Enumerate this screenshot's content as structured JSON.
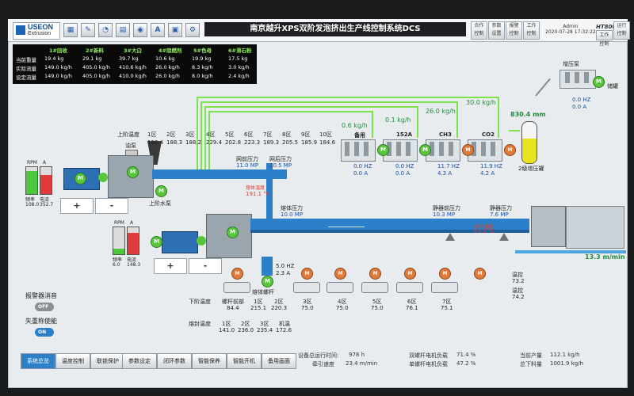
{
  "header": {
    "logo_top": "USEON",
    "logo_bottom": "Extrusion",
    "title": "南京越升XPS双阶发泡挤出生产线控制系统DCS",
    "buttons": [
      "合作\n控制",
      "参数\n设置",
      "报警\n控制",
      "工作\n控制",
      "工作\n控制",
      "运行\n控制"
    ],
    "user": "Admin",
    "datetime": "2020-07-28 17:32:22",
    "brand": "HT8000"
  },
  "feed_table": {
    "columns": [
      "1#回收",
      "2#新料",
      "3#大白",
      "4#阻燃剂",
      "5#色母",
      "6#滑石粉"
    ],
    "row_labels": [
      "当前重量",
      "实际流量",
      "设定流量"
    ],
    "rows": [
      [
        "19.4 kg",
        "29.1 kg",
        "39.7 kg",
        "10.6 kg",
        "19.9 kg",
        "17.5 kg"
      ],
      [
        "149.0 kg/h",
        "405.0 kg/h",
        "410.6 kg/h",
        "26.0 kg/h",
        "8.3 kg/h",
        "3.0 kg/h"
      ],
      [
        "149.0 kg/h",
        "405.0 kg/h",
        "410.0 kg/h",
        "26.0 kg/h",
        "8.0 kg/h",
        "2.4 kg/h"
      ]
    ]
  },
  "upper_stage": {
    "title": "上阶温度",
    "feeder_label": "油泵",
    "zones": [
      "1区",
      "2区",
      "3区",
      "4区",
      "5区",
      "6区",
      "7区",
      "8区",
      "9区",
      "10区"
    ],
    "temps": [
      "188.4",
      "188.3",
      "188.2",
      "229.4",
      "202.8",
      "223.3",
      "189.3",
      "205.5",
      "185.9",
      "184.6"
    ],
    "water_label": "上阶水泵",
    "p_before_label": "网前压力",
    "p_before": "11.0 MP",
    "p_after_label": "网后压力",
    "p_after": "10.5 MP",
    "melt_label": "熔体温度",
    "melt_temp": "191.1 °C",
    "rpm_label": "RPM",
    "amp_label": "A",
    "speed_label": "频率",
    "speed": "108.0",
    "current_label": "电流",
    "current": "352.7",
    "minus": "-",
    "plus": "+"
  },
  "gas_lines": {
    "flows": [
      "0.6 kg/h",
      "0.1 kg/h",
      "26.0 kg/h",
      "30.0 kg/h"
    ],
    "units": [
      {
        "name": "备用",
        "hz": "0.0 HZ",
        "a": "0.0 A"
      },
      {
        "name": "152A",
        "hz": "0.0 HZ",
        "a": "0.0 A"
      },
      {
        "name": "CH3",
        "hz": "11.7 HZ",
        "a": "4.3 A"
      },
      {
        "name": "CO2",
        "hz": "11.9 HZ",
        "a": "4.2 A"
      }
    ],
    "tank_total": "830.4 mm",
    "tank_label": "2级增压罐",
    "booster_label": "增压泵",
    "booster_hz": "0.0 HZ",
    "booster_a": "0.0 A",
    "storage_label": "储罐"
  },
  "lower_stage": {
    "title": "下阶温度",
    "melt_p_label": "熔体压力",
    "melt_p": "10.0 MP",
    "screw_hz": "5.0 HZ",
    "screw_a": "2.3 A",
    "screw_label": "熔体螺杆",
    "pre_label": "静器前压力",
    "pre_p": "10.3 MP",
    "post_label": "静器压力",
    "post_p": "7.6 MP",
    "die_melt_label": "熔体温度",
    "die_melt": "93.2 °C",
    "speed_label": "频率",
    "speed": "6.0",
    "current_label": "电流",
    "current": "148.3",
    "rpm_label": "RPM",
    "amp_label": "A",
    "minus": "-",
    "plus": "+",
    "line_speed": "13.3 m/min",
    "zone_head": "螺杆前部",
    "zone_head_val": "84.4",
    "zones": [
      "1区",
      "2区",
      "3区",
      "4区",
      "5区",
      "6区",
      "7区"
    ],
    "temps": [
      "215.1",
      "220.3",
      "75.0",
      "75.0",
      "75.0",
      "76.1",
      "75.1"
    ],
    "seal_label": "熔封温度",
    "seal_zones": [
      "1区",
      "2区",
      "3区",
      "机温"
    ],
    "seal_temps": [
      "141.0",
      "236.0",
      "235.4",
      "172.6"
    ],
    "side_a": "温控",
    "side_a_val": "73.2",
    "side_b": "温控",
    "side_b_val": "74.2"
  },
  "controls": {
    "alarm_label": "报警器消音",
    "alarm_state": "OFF",
    "enable_label": "失重称使能",
    "enable_state": "ON"
  },
  "bottom_nav": [
    "系统总览",
    "温度控制",
    "联锁保护",
    "参数设定",
    "闭环参数",
    "智能保养",
    "智能开机",
    "备用画面"
  ],
  "bottom_status": {
    "runtime_label": "设备总运行时间:",
    "runtime": "978 h",
    "traction_label": "牵引速度",
    "traction": "23.4 m/min",
    "dual_load_label": "双螺杆电机负载",
    "dual_load": "71.4 %",
    "single_load_label": "单螺杆电机负载",
    "single_load": "47.2 %",
    "yield_label": "当前产量",
    "yield": "112.1 kg/h",
    "total_label": "总下料量",
    "total": "1001.9 kg/h"
  }
}
